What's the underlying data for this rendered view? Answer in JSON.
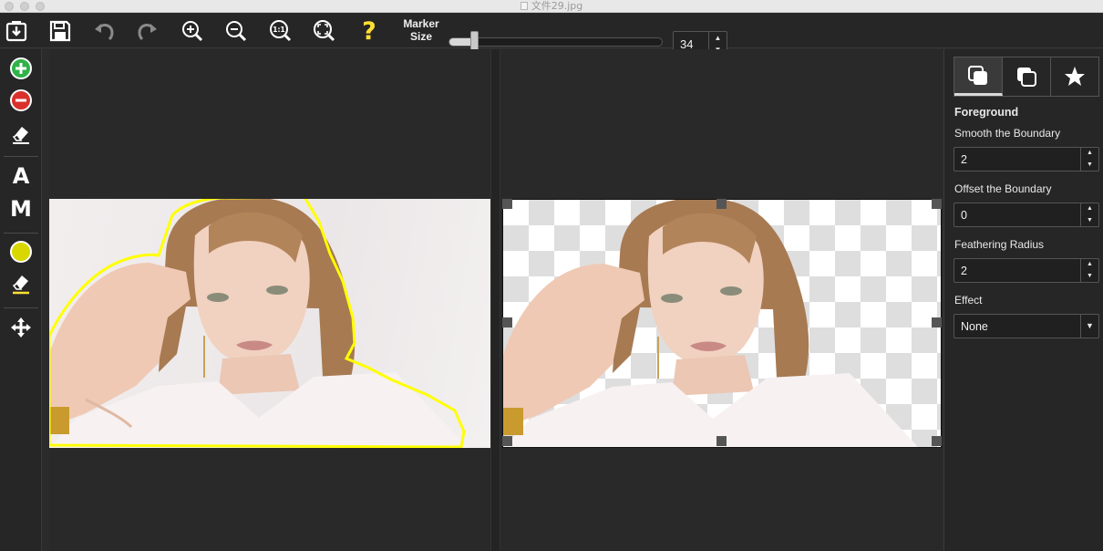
{
  "window": {
    "title": "文件29.jpg"
  },
  "toolbar": {
    "items": [
      "import-icon",
      "save-icon",
      "undo-icon",
      "redo-icon",
      "zoom-in-icon",
      "zoom-out-icon",
      "actual-size-icon",
      "fit-screen-icon",
      "help-icon"
    ],
    "help_label": "?",
    "zoom_actual_label": "1:1",
    "marker_size_label": "Marker Size",
    "marker_size_value": "34",
    "marker_size_fraction": 0.12
  },
  "left_tools": {
    "items": [
      "add-foreground-icon",
      "remove-background-icon",
      "eraser-icon",
      "auto-mode",
      "manual-mode",
      "marker-color-icon",
      "marker-eraser-icon",
      "move-icon"
    ],
    "auto_label": "A",
    "manual_label": "M"
  },
  "colors": {
    "accent_yellow": "#ffe033",
    "add_green": "#2fb34a",
    "remove_red": "#d9302c",
    "panel_bg": "#262626",
    "canvas_bg": "#292929"
  },
  "right_panel": {
    "tabs": [
      "foreground-tab-icon",
      "background-tab-icon",
      "effects-tab-icon"
    ],
    "section_title": "Foreground",
    "smooth_label": "Smooth the Boundary",
    "smooth_value": "2",
    "offset_label": "Offset the Boundary",
    "offset_value": "0",
    "feather_label": "Feathering Radius",
    "feather_value": "2",
    "effect_label": "Effect",
    "effect_value": "None"
  }
}
